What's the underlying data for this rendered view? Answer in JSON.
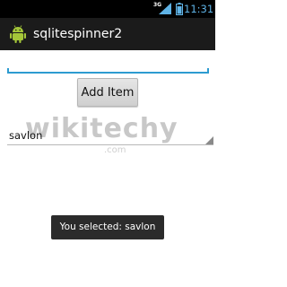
{
  "status_bar": {
    "network": "3G",
    "time": "11:31",
    "accent_color": "#5fb3e6",
    "icons": [
      "signal-icon",
      "battery-icon"
    ]
  },
  "action_bar": {
    "title": "sqlitespinner2",
    "icon": "android-icon"
  },
  "form": {
    "input_value": "",
    "input_placeholder": "",
    "add_button_label": "Add Item",
    "accent_color": "#2d9bd0"
  },
  "spinner": {
    "selected_value": "savlon",
    "icon": "dropdown-triangle-icon"
  },
  "watermark": {
    "text": "wikitechy",
    "suffix": ".com"
  },
  "toast": {
    "message": "You selected: savlon"
  }
}
